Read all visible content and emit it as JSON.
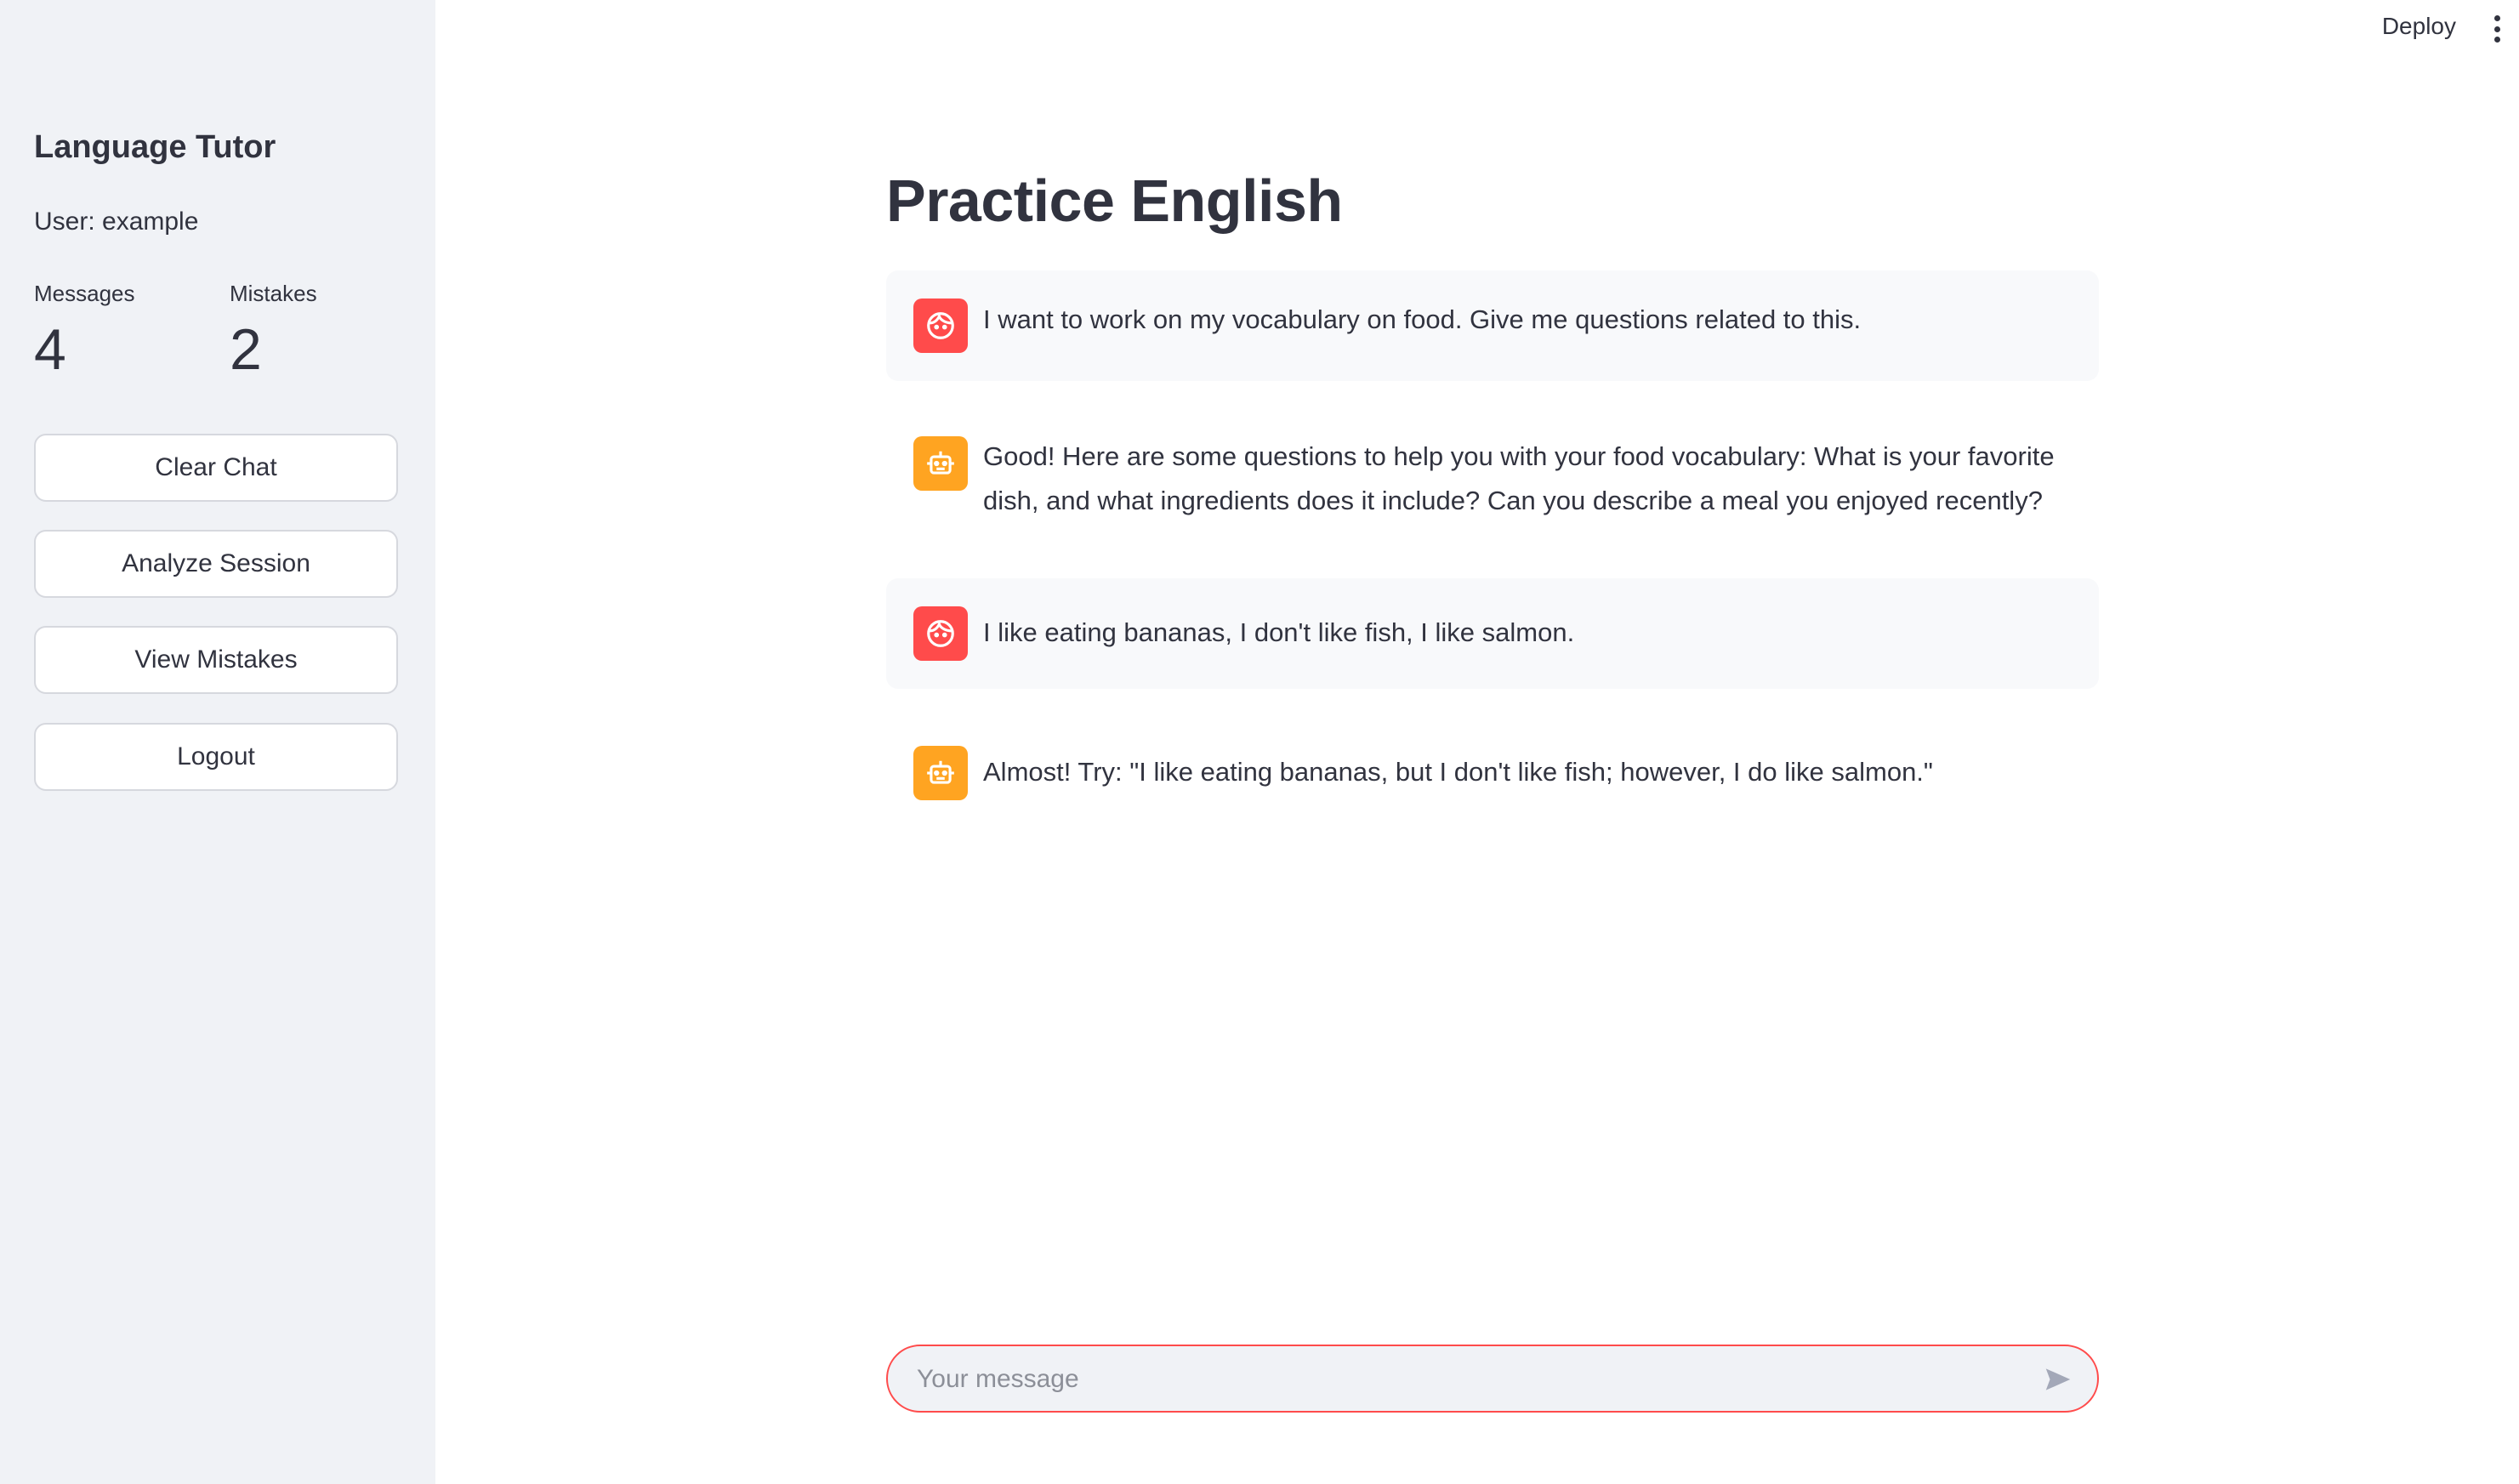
{
  "toolbar": {
    "deploy_label": "Deploy"
  },
  "sidebar": {
    "title": "Language Tutor",
    "user_line": "User: example",
    "metrics": [
      {
        "label": "Messages",
        "value": "4"
      },
      {
        "label": "Mistakes",
        "value": "2"
      }
    ],
    "buttons": [
      {
        "label": "Clear Chat"
      },
      {
        "label": "Analyze Session"
      },
      {
        "label": "View Mistakes"
      },
      {
        "label": "Logout"
      }
    ]
  },
  "main": {
    "title": "Practice English",
    "messages": [
      {
        "role": "user",
        "avatar_icon": "user-face-icon",
        "text": "I want to work on my vocabulary on food. Give me questions related to this."
      },
      {
        "role": "assistant",
        "avatar_icon": "robot-icon",
        "text": "Good! Here are some questions to help you with your food vocabulary: What is your favorite dish, and what ingredients does it include? Can you describe a meal you enjoyed recently?"
      },
      {
        "role": "user",
        "avatar_icon": "user-face-icon",
        "text": "I like eating bananas, I don't like fish, I like salmon."
      },
      {
        "role": "assistant",
        "avatar_icon": "robot-icon",
        "text": "Almost! Try: \"I like eating bananas, but I don't like fish; however, I do like salmon.\""
      }
    ]
  },
  "chat_input": {
    "placeholder": "Your message",
    "value": "",
    "send_icon": "send-icon"
  },
  "colors": {
    "sidebar_bg": "#f0f2f6",
    "user_avatar": "#ff4b4b",
    "assistant_avatar": "#ffa421",
    "input_border": "#ff4b4b",
    "text": "#31333f"
  }
}
